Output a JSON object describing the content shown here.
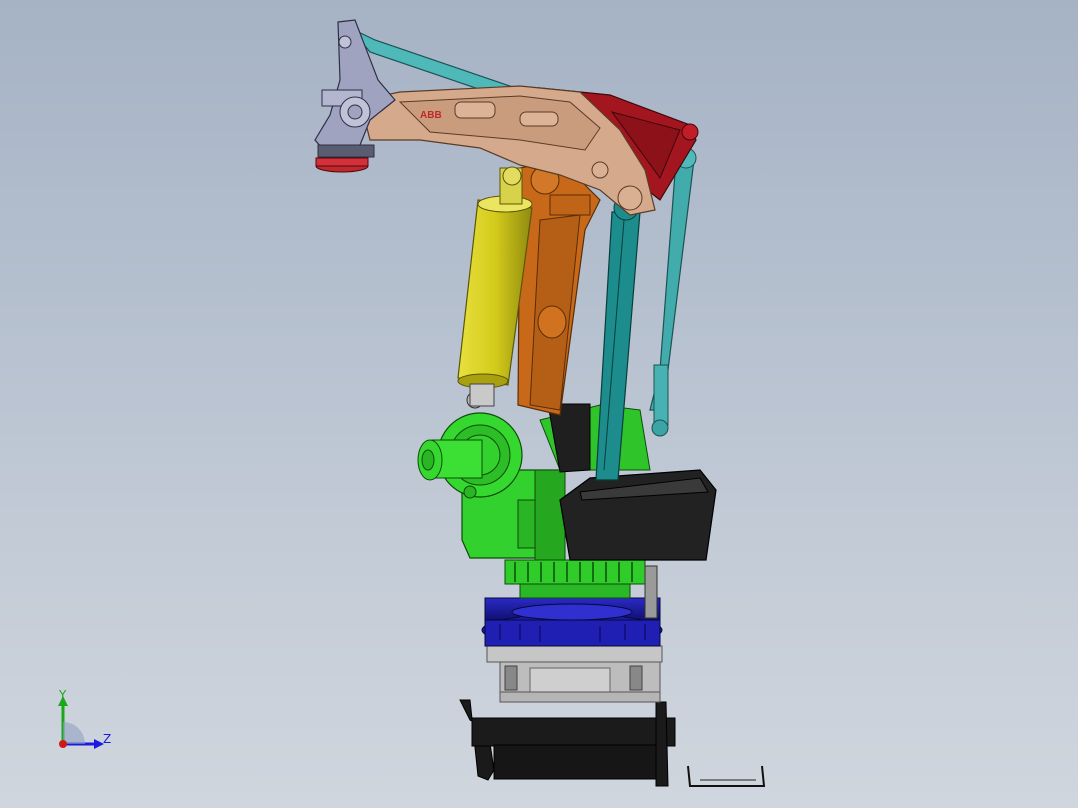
{
  "viewport": {
    "background_top": "#a6b3c5",
    "background_bottom": "#d0d6de"
  },
  "model": {
    "logo_text": "ABB",
    "parts": [
      {
        "name": "gripper-flange",
        "color": "#c0282c"
      },
      {
        "name": "wrist-housing",
        "color": "#9fa3bf"
      },
      {
        "name": "upper-arm",
        "color": "#d4a98c"
      },
      {
        "name": "parallel-link-housing",
        "color": "#a3161f"
      },
      {
        "name": "tie-rod",
        "color": "#4fb8b8"
      },
      {
        "name": "balancer-cylinder",
        "color": "#d4cc1a"
      },
      {
        "name": "lower-arm",
        "color": "#c8691a"
      },
      {
        "name": "parallel-arm",
        "color": "#1c8c8c"
      },
      {
        "name": "frame",
        "color": "#2fd12a"
      },
      {
        "name": "motor-cover",
        "color": "#1f1f1f"
      },
      {
        "name": "slewing-ring",
        "color": "#1a1ab0"
      },
      {
        "name": "riser",
        "color": "#c4c4c4"
      },
      {
        "name": "base-pedestal",
        "color": "#151515"
      }
    ]
  },
  "triad": {
    "y_label": "Y",
    "z_label": "Z",
    "y_color": "#1aa81a",
    "z_color": "#1a1ae0",
    "x_color": "#d01818"
  }
}
